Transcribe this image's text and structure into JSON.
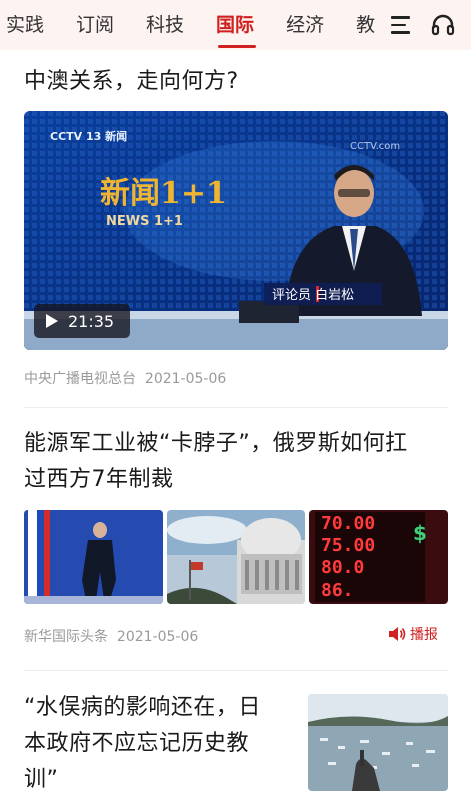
{
  "tabs": [
    {
      "label": "实践"
    },
    {
      "label": "订阅"
    },
    {
      "label": "科技"
    },
    {
      "label": "国际",
      "active": true
    },
    {
      "label": "经济"
    },
    {
      "label": "教"
    }
  ],
  "icons": {
    "menu": "menu-icon",
    "audio": "headphones-icon"
  },
  "accent_color": "#d0201f",
  "articles": [
    {
      "title": "中澳关系，走向何方?",
      "video_duration": "21:35",
      "video_overlay": {
        "channel_logo": "CCTV 13 新闻",
        "program": "新闻1+1",
        "program_en": "NEWS 1+1",
        "caption": "评论员 白岩松",
        "corner_logo": "CCTV.com"
      },
      "source": "中央广播电视总台",
      "date": "2021-05-06"
    },
    {
      "title_line1": "能源军工业被“卡脖子”，俄罗斯如何扛",
      "title_line2": "过西方7年制裁",
      "source": "新华国际头条",
      "date": "2021-05-06",
      "play_label": "播报",
      "thumb3_text": [
        "70.00",
        "75.00",
        "80.0",
        "86."
      ]
    },
    {
      "title_line1": "“水俣病的影响还在，日",
      "title_line2": "本政府不应忘记历史教",
      "title_line3": "训”"
    }
  ]
}
